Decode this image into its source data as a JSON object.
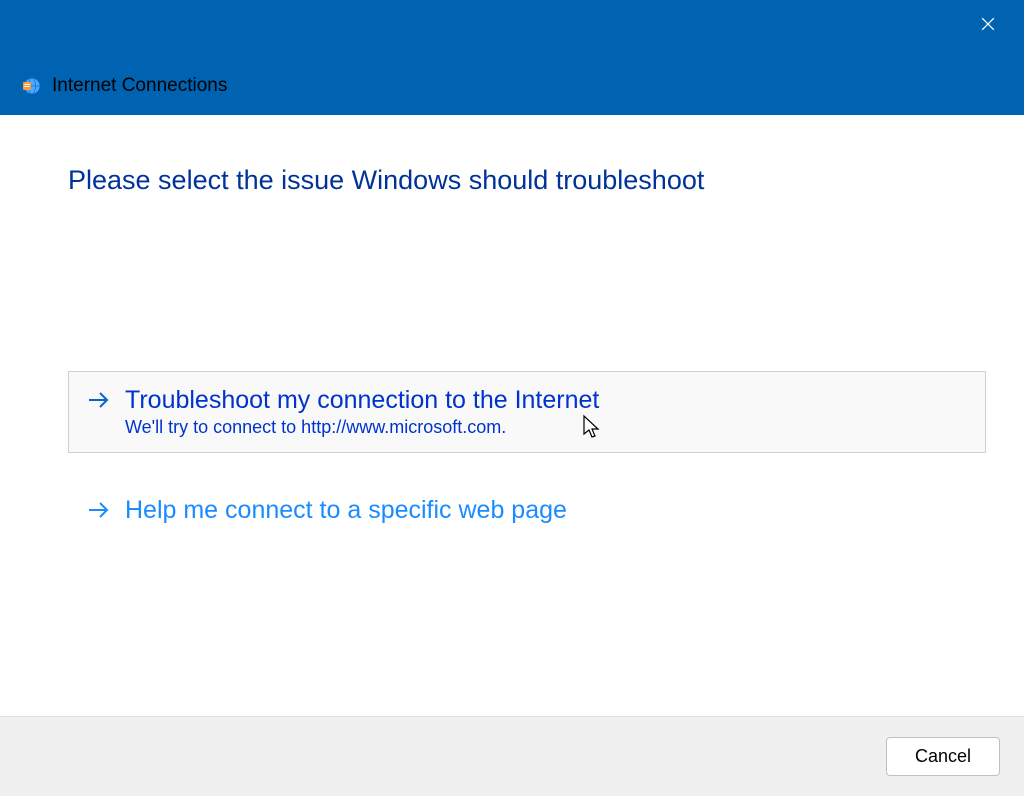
{
  "window": {
    "title": "Internet Connections"
  },
  "heading": "Please select the issue Windows should troubleshoot",
  "options": [
    {
      "title": "Troubleshoot my connection to the Internet",
      "subtitle": "We'll try to connect to http://www.microsoft.com."
    },
    {
      "title": "Help me connect to a specific web page",
      "subtitle": ""
    }
  ],
  "footer": {
    "cancel_label": "Cancel"
  }
}
